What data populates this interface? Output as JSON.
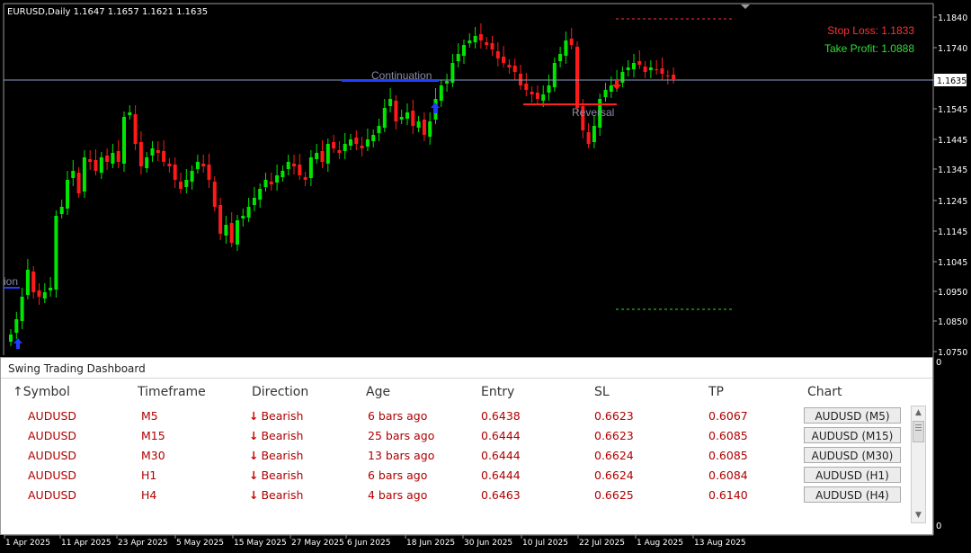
{
  "chart": {
    "symbol_line": "EURUSD,Daily  1.1647 1.1657 1.1621 1.1635",
    "stop_loss_text": "Stop Loss: 1.1833",
    "take_profit_text": "Take Profit: 1.0888",
    "continuation_label": "Continuation",
    "reversal_label": "Reversal",
    "left_edge_label": "ion",
    "current_price": "1.1635",
    "price_ticks": [
      "1.1840",
      "1.1740",
      "1.1635",
      "1.1545",
      "1.1445",
      "1.1345",
      "1.1245",
      "1.1145",
      "1.1045",
      "1.0950",
      "1.0850",
      "1.0750"
    ],
    "date_ticks": [
      "1 Apr 2025",
      "11 Apr 2025",
      "23 Apr 2025",
      "5 May 2025",
      "15 May 2025",
      "27 May 2025",
      "6 Jun 2025",
      "18 Jun 2025",
      "30 Jun 2025",
      "10 Jul 2025",
      "22 Jul 2025",
      "1 Aug 2025",
      "13 Aug 2025"
    ],
    "indicator_zero_top": "0",
    "indicator_zero_bottom": "0",
    "colors": {
      "bull": "#00e600",
      "bear": "#ff1a1a",
      "stop_loss": "#ff3333",
      "take_profit": "#33dd33",
      "signal_up": "#1e3cff",
      "signal_down": "#ff1a1a"
    }
  },
  "dashboard": {
    "title": "Swing Trading Dashboard",
    "columns": [
      "Symbol",
      "Timeframe",
      "Direction",
      "Age",
      "Entry",
      "SL",
      "TP",
      "Chart"
    ],
    "sort_icon": "sort-up-arrow-icon",
    "rows": [
      {
        "symbol": "AUDUSD",
        "timeframe": "M5",
        "direction": "Bearish",
        "age": "6 bars ago",
        "entry": "0.6438",
        "sl": "0.6623",
        "tp": "0.6067",
        "chart": "AUDUSD (M5)"
      },
      {
        "symbol": "AUDUSD",
        "timeframe": "M15",
        "direction": "Bearish",
        "age": "25 bars ago",
        "entry": "0.6444",
        "sl": "0.6623",
        "tp": "0.6085",
        "chart": "AUDUSD (M15)"
      },
      {
        "symbol": "AUDUSD",
        "timeframe": "M30",
        "direction": "Bearish",
        "age": "13 bars ago",
        "entry": "0.6444",
        "sl": "0.6624",
        "tp": "0.6085",
        "chart": "AUDUSD (M30)"
      },
      {
        "symbol": "AUDUSD",
        "timeframe": "H1",
        "direction": "Bearish",
        "age": "6 bars ago",
        "entry": "0.6444",
        "sl": "0.6624",
        "tp": "0.6084",
        "chart": "AUDUSD (H1)"
      },
      {
        "symbol": "AUDUSD",
        "timeframe": "H4",
        "direction": "Bearish",
        "age": "4 bars ago",
        "entry": "0.6463",
        "sl": "0.6625",
        "tp": "0.6140",
        "chart": "AUDUSD (H4)"
      }
    ]
  }
}
